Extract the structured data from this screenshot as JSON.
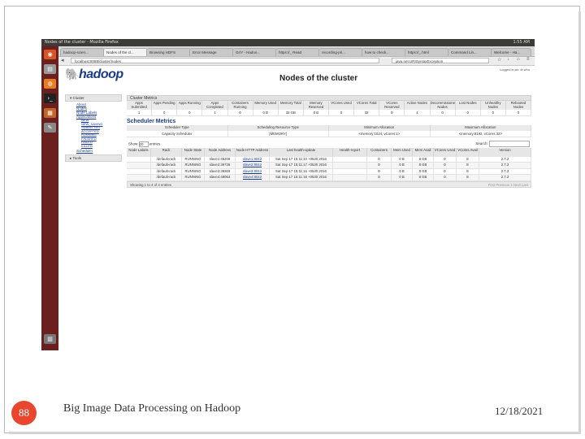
{
  "slide": {
    "page_number": "88",
    "footer_title": "Big Image Data Processing on Hadoop",
    "date": "12/18/2021"
  },
  "os": {
    "window_title": "Nodes of the cluster - Mozilla Firefox",
    "clock": "1:55 AM"
  },
  "browser": {
    "tabs": [
      "hadoop-scien...",
      "Nodes of the cl...",
      "Browsing HDFS",
      "Error Message",
      "Gr/Y - Hadoo...",
      "https://_ Read",
      "recording-pri...",
      "how to check...",
      "https://_.html",
      "Command Lin...",
      "Welcome - Ha..."
    ],
    "url": "localhost:8088/cluster/nodes",
    "search": "java.net.URISyntaxException"
  },
  "hadoop": {
    "logo": "hadoop",
    "page_title": "Nodes of the cluster",
    "logged_in": "Logged in as: dr.who",
    "nav": {
      "cluster": "Cluster",
      "links": [
        "About",
        "Nodes",
        "Node Labels",
        "Applications"
      ],
      "app_states": [
        "NEW",
        "NEW_SAVING",
        "SUBMITTED",
        "ACCEPTED",
        "RUNNING",
        "FINISHED",
        "FAILED",
        "KILLED"
      ],
      "scheduler": "Scheduler",
      "tools": "Tools"
    },
    "cluster_metrics": {
      "title": "Cluster Metrics",
      "headers": [
        "Apps Submitted",
        "Apps Pending",
        "Apps Running",
        "Apps Completed",
        "Containers Running",
        "Memory Used",
        "Memory Total",
        "Memory Reserved",
        "VCores Used",
        "VCores Total",
        "VCores Reserved",
        "Active Nodes",
        "Decommissioned Nodes",
        "Lost Nodes",
        "Unhealthy Nodes",
        "Rebooted Nodes"
      ],
      "values": [
        "1",
        "0",
        "0",
        "1",
        "0",
        "0 B",
        "32 GB",
        "0 B",
        "0",
        "32",
        "0",
        "4",
        "0",
        "0",
        "0",
        "0"
      ]
    },
    "scheduler_metrics": {
      "title": "Scheduler Metrics",
      "headers": [
        "Scheduler Type",
        "Scheduling Resource Type",
        "Minimum Allocation",
        "Maximum Allocation"
      ],
      "values": [
        "Capacity Scheduler",
        "[MEMORY]",
        "<memory:1024, vCores:1>",
        "<memory:8192, vCores:32>"
      ]
    },
    "table_controls": {
      "show": "Show",
      "show_value": "20",
      "entries": "entries",
      "search": "Search:"
    },
    "nodes": {
      "headers": [
        "Node Labels",
        "Rack",
        "Node State",
        "Node Address",
        "Node HTTP Address",
        "Last health-update",
        "Health-report",
        "Containers",
        "Mem Used",
        "Mem Avail",
        "VCores Used",
        "VCores Avail",
        "Version"
      ],
      "rows": [
        [
          "",
          "/default-rack",
          "RUNNING",
          "slave1:45209",
          "slave1:8042",
          "Sat Sep 17 15:11:10 +0530 2016",
          "",
          "0",
          "0 B",
          "8 GB",
          "0",
          "8",
          "2.7.2"
        ],
        [
          "",
          "/default-rack",
          "RUNNING",
          "slave2:39726",
          "slave2:8042",
          "Sat Sep 17 15:11:17 +0530 2016",
          "",
          "0",
          "0 B",
          "8 GB",
          "0",
          "8",
          "2.7.2"
        ],
        [
          "",
          "/default-rack",
          "RUNNING",
          "slave3:38369",
          "slave3:8042",
          "Sat Sep 17 15:11:16 +0530 2016",
          "",
          "0",
          "0 B",
          "8 GB",
          "0",
          "8",
          "2.7.2"
        ],
        [
          "",
          "/default-rack",
          "RUNNING",
          "slave4:48063",
          "slave4:8042",
          "Sat Sep 17 15:11:18 +0530 2016",
          "",
          "0",
          "0 B",
          "8 GB",
          "0",
          "8",
          "2.7.2"
        ]
      ],
      "footer_info": "Showing 1 to 4 of 4 entries",
      "pager": "First  Previous  1  Next  Last"
    }
  },
  "colors": {
    "page_number_circle": "#e8462e",
    "launcher": "#6b1f1f",
    "hadoop_blue": "#1b3b8a"
  }
}
